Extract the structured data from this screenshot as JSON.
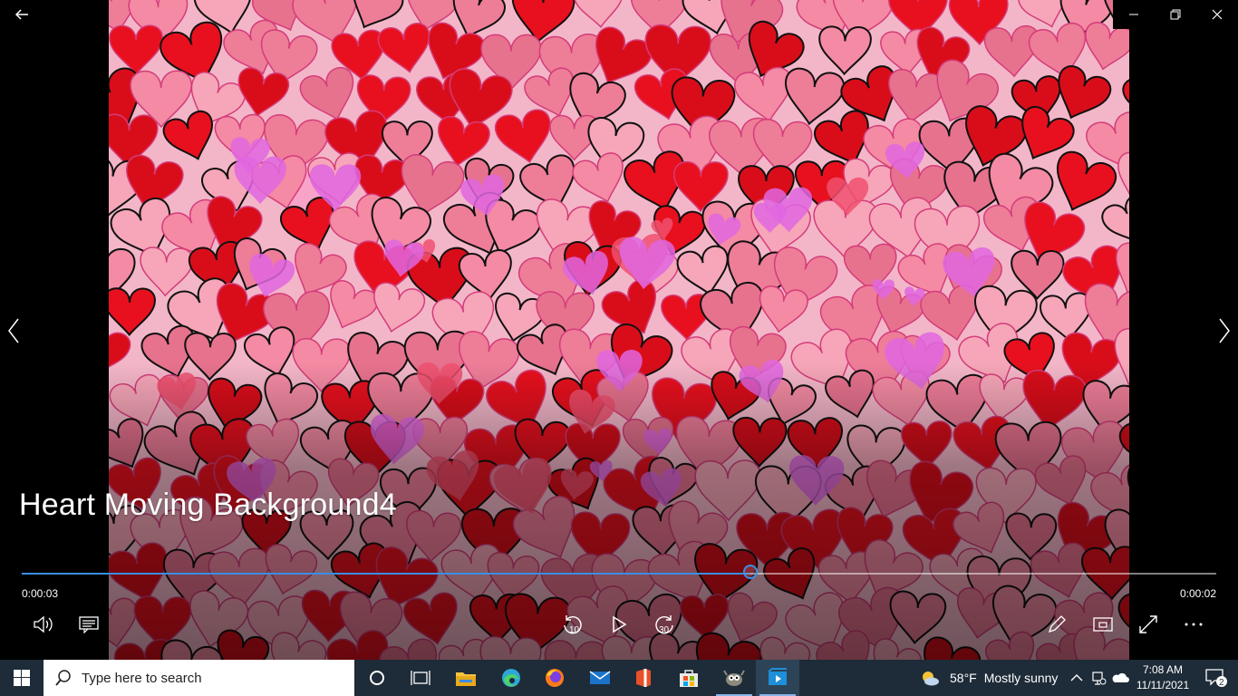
{
  "player": {
    "video_title": "Heart Moving Background4",
    "time_elapsed": "0:00:03",
    "time_remaining": "0:00:02",
    "progress_fraction": 0.61,
    "accent_color": "#3a8ee6"
  },
  "window": {
    "icons": [
      "back-arrow-icon",
      "minimize-icon",
      "restore-icon",
      "close-icon"
    ]
  },
  "controls": {
    "left": [
      "volume-icon",
      "subtitles-icon"
    ],
    "center": {
      "skip_back_label": "10",
      "skip_forward_label": "30"
    },
    "right": [
      "edit-pencil-icon",
      "mini-view-icon",
      "fullscreen-icon",
      "more-options-icon"
    ]
  },
  "taskbar": {
    "search_placeholder": "Type here to search",
    "pinned": [
      "cortana-icon",
      "task-view-icon",
      "file-explorer-icon",
      "edge-icon",
      "firefox-icon",
      "mail-icon",
      "office-icon",
      "store-icon",
      "gimp-icon",
      "movies-tv-icon"
    ],
    "weather_temp": "58°F",
    "weather_desc": "Mostly sunny",
    "time": "7:08 AM",
    "date": "11/11/2021",
    "notification_count": "2"
  }
}
